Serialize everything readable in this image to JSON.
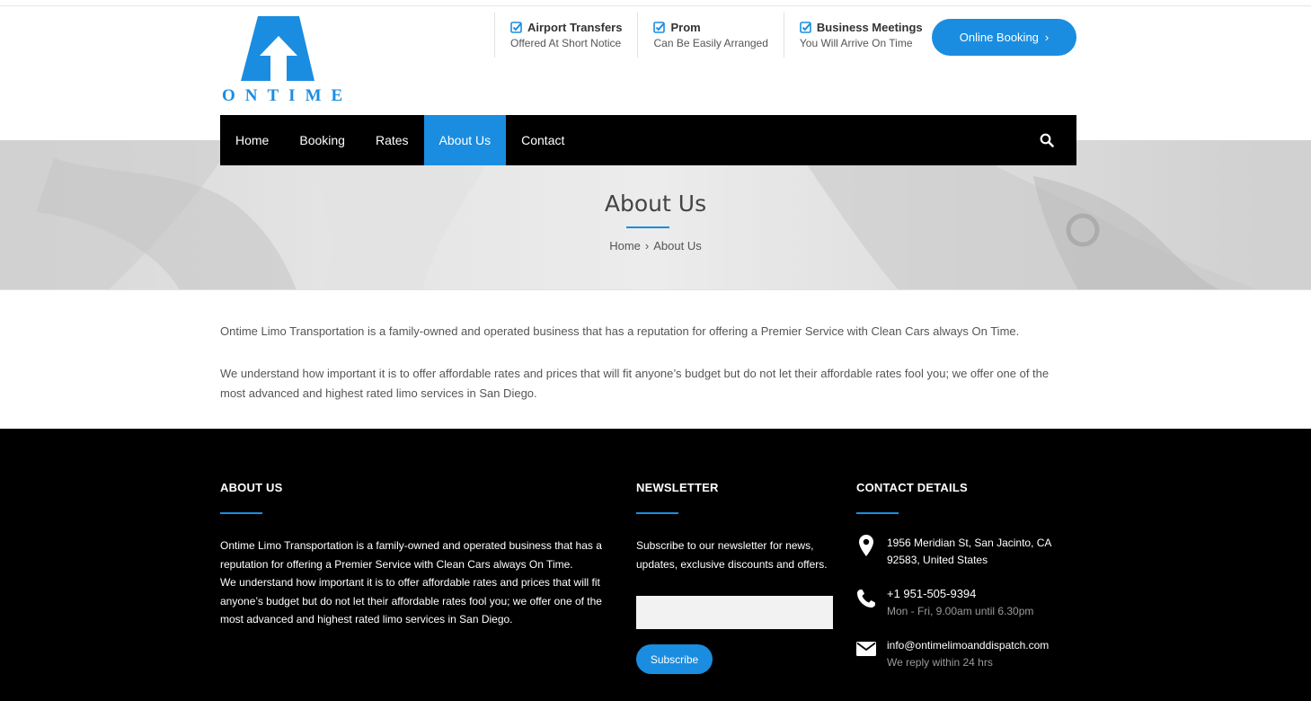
{
  "brand": {
    "logo_text": "ONTIME",
    "accent_color": "#1a8de0"
  },
  "header": {
    "features": [
      {
        "title": "Airport Transfers",
        "subtitle": "Offered At Short Notice",
        "icon": "checkbox-icon"
      },
      {
        "title": "Prom",
        "subtitle": "Can Be Easily Arranged",
        "icon": "checkbox-icon"
      },
      {
        "title": "Business Meetings",
        "subtitle": "You Will Arrive On Time",
        "icon": "checkbox-icon"
      }
    ],
    "booking_button": {
      "label": "Online Booking",
      "chevron": "›"
    }
  },
  "nav": {
    "items": [
      {
        "label": "Home"
      },
      {
        "label": "Booking"
      },
      {
        "label": "Rates"
      },
      {
        "label": "About Us"
      },
      {
        "label": "Contact"
      }
    ],
    "active": "About Us",
    "search_icon": "search-icon"
  },
  "hero": {
    "title": "About Us",
    "breadcrumb": {
      "home": "Home",
      "separator": "›",
      "current": "About Us"
    }
  },
  "content": {
    "paragraphs": [
      "Ontime Limo Transportation is a family-owned and operated business that has a reputation for offering a Premier Service with Clean Cars always On Time.",
      "We understand how important it is to offer affordable rates and prices that will fit anyone’s budget but do not let their affordable rates fool you; we offer one of the most advanced and highest rated limo services in San Diego."
    ]
  },
  "footer": {
    "about": {
      "heading": "ABOUT US",
      "line1": "Ontime Limo Transportation is a family-owned and operated business that has a reputation for offering a Premier Service with Clean Cars always On Time.",
      "line2": "We understand how important it is to offer affordable rates and prices that will fit anyone’s budget but do not let their affordable rates fool you; we offer one of the most advanced and highest rated limo services in San Diego."
    },
    "newsletter": {
      "heading": "NEWSLETTER",
      "text": "Subscribe to our newsletter for news, updates, exclusive discounts and offers.",
      "input_value": "",
      "button_label": "Subscribe"
    },
    "contact": {
      "heading": "CONTACT DETAILS",
      "address_line1": "1956 Meridian St, San Jacinto, CA",
      "address_line2": "92583, United States",
      "phone": "+1 951-505-9394",
      "hours": "Mon - Fri, 9.00am until 6.30pm",
      "email": "info@ontimelimoanddispatch.com",
      "email_note": "We reply within 24 hrs"
    }
  }
}
